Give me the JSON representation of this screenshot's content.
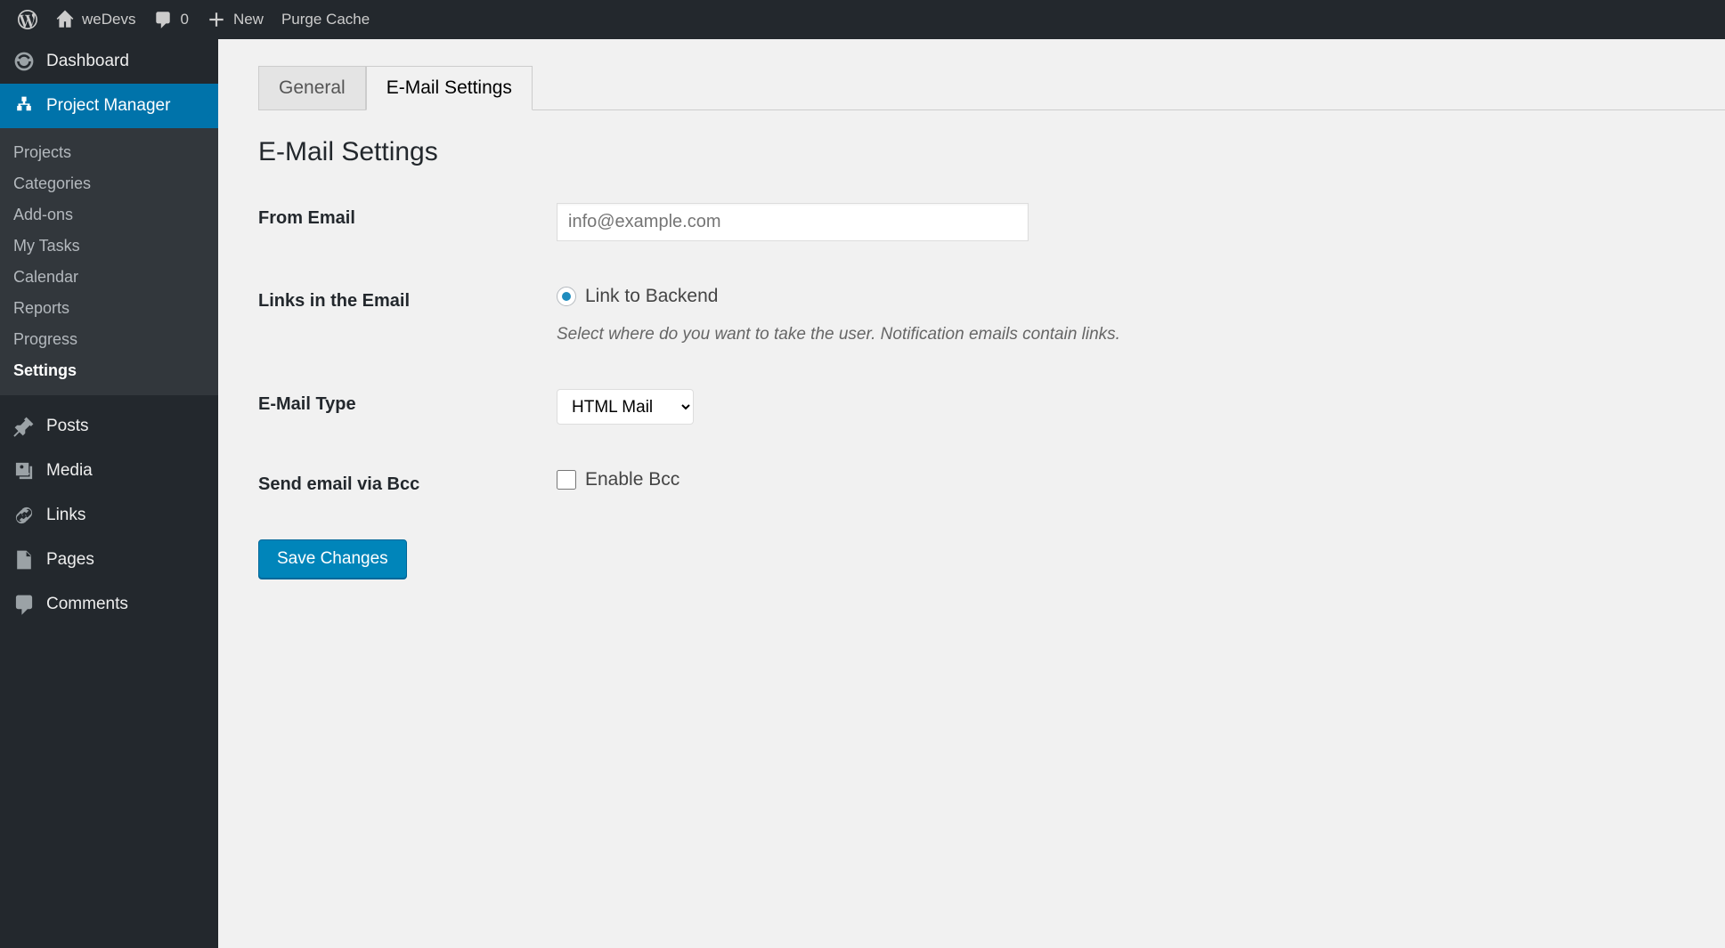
{
  "adminbar": {
    "site_name": "weDevs",
    "comments_count": "0",
    "new_label": "New",
    "purge_cache": "Purge Cache"
  },
  "sidebar": {
    "dashboard": "Dashboard",
    "project_manager": "Project Manager",
    "submenu": {
      "projects": "Projects",
      "categories": "Categories",
      "addons": "Add-ons",
      "my_tasks": "My Tasks",
      "calendar": "Calendar",
      "reports": "Reports",
      "progress": "Progress",
      "settings": "Settings"
    },
    "posts": "Posts",
    "media": "Media",
    "links": "Links",
    "pages": "Pages",
    "comments": "Comments"
  },
  "tabs": {
    "general": "General",
    "email_settings": "E-Mail Settings"
  },
  "page": {
    "title": "E-Mail Settings",
    "from_email_label": "From Email",
    "from_email_placeholder": "info@example.com",
    "links_label": "Links in the Email",
    "links_option_backend": "Link to Backend",
    "links_desc": "Select where do you want to take the user. Notification emails contain links.",
    "email_type_label": "E-Mail Type",
    "email_type_value": "HTML Mail",
    "bcc_label": "Send email via Bcc",
    "bcc_option": "Enable Bcc",
    "save_button": "Save Changes"
  }
}
